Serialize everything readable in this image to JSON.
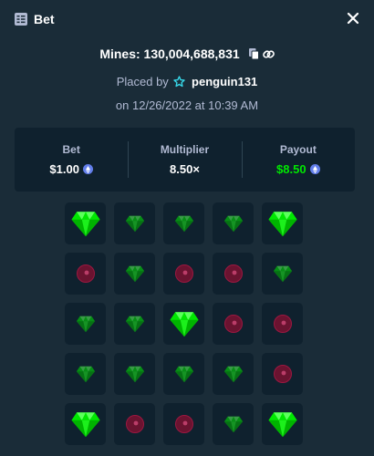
{
  "header": {
    "title": "Bet"
  },
  "mines_label": "Mines: 130,004,688,831",
  "placed_by": {
    "prefix": "Placed by",
    "user": "penguin131"
  },
  "date": "on 12/26/2022 at 10:39 AM",
  "stats": {
    "bet": {
      "label": "Bet",
      "value": "$1.00"
    },
    "multiplier": {
      "label": "Multiplier",
      "value": "8.50×"
    },
    "payout": {
      "label": "Payout",
      "value": "$8.50"
    }
  },
  "colors": {
    "background": "#1a2c38",
    "panel": "#0f212e",
    "gem": "#00e701",
    "mine": "#7a1030",
    "payout": "#00e701",
    "coin": "#627eea"
  },
  "grid": [
    [
      "gem-big",
      "gem",
      "gem",
      "gem",
      "gem-big"
    ],
    [
      "mine",
      "gem",
      "mine",
      "mine",
      "gem"
    ],
    [
      "gem",
      "gem",
      "gem-big",
      "mine",
      "mine"
    ],
    [
      "gem",
      "gem",
      "gem",
      "gem",
      "mine"
    ],
    [
      "gem-big",
      "mine",
      "mine",
      "gem",
      "gem-big"
    ]
  ]
}
